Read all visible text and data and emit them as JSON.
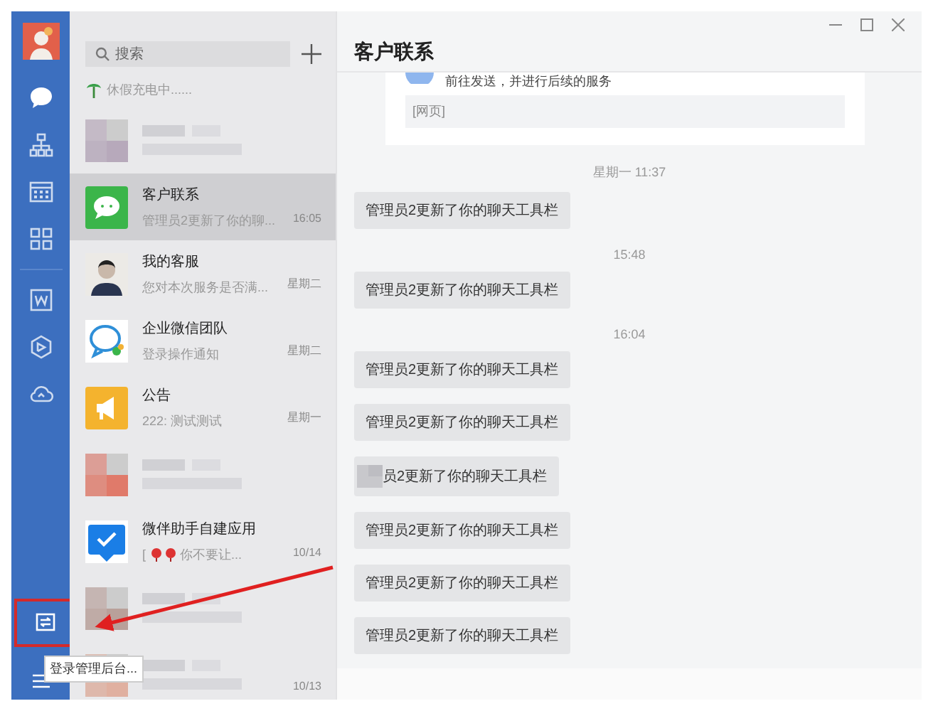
{
  "sidebar": {
    "nav": [
      {
        "kind": "chat",
        "selected": true
      },
      {
        "kind": "org",
        "selected": false
      },
      {
        "kind": "calendar",
        "selected": false
      },
      {
        "kind": "apps",
        "selected": false
      },
      {
        "kind": "doc",
        "selected": false
      },
      {
        "kind": "hex",
        "selected": false
      },
      {
        "kind": "cloud",
        "selected": false
      }
    ],
    "bottom": [
      {
        "kind": "admin",
        "highlighted": true
      },
      {
        "kind": "menu",
        "highlighted": false
      }
    ],
    "tooltip": "登录管理后台..."
  },
  "search": {
    "placeholder": "搜索"
  },
  "status": "休假充电中......",
  "conversations": [
    {
      "kind": "blurred",
      "color": "#b7a9bb",
      "selected": false
    },
    {
      "kind": "bubble",
      "name": "客户联系",
      "preview": "管理员2更新了你的聊...",
      "time": "16:05",
      "selected": true
    },
    {
      "kind": "person",
      "name": "我的客服",
      "preview": "您对本次服务是否满...",
      "time": "星期二",
      "selected": false
    },
    {
      "kind": "team",
      "name": "企业微信团队",
      "preview": "登录操作通知",
      "time": "星期二",
      "selected": false
    },
    {
      "kind": "megaphone",
      "name": "公告",
      "preview": "222: 测试测试",
      "time": "星期一",
      "selected": false
    },
    {
      "kind": "blurred",
      "color": "#e07a6a",
      "selected": false
    },
    {
      "kind": "check",
      "name": "微伴助手自建应用",
      "prefix": "[",
      "preview": "你不要让...",
      "time": "10/14",
      "selected": false
    },
    {
      "kind": "blurred",
      "color": "#b9a09a",
      "selected": false
    },
    {
      "kind": "blurred",
      "color": "#e0b0a0",
      "time": "10/13",
      "selected": false
    }
  ],
  "chat": {
    "title": "客户联系",
    "card": {
      "text": "前往发送，并进行后续的服务",
      "link": "[网页]"
    },
    "messages": [
      {
        "kind": "time",
        "text": "星期一 11:37"
      },
      {
        "kind": "message",
        "text": "管理员2更新了你的聊天工具栏"
      },
      {
        "kind": "time",
        "text": "15:48"
      },
      {
        "kind": "message",
        "text": "管理员2更新了你的聊天工具栏"
      },
      {
        "kind": "time",
        "text": "16:04"
      },
      {
        "kind": "message",
        "text": "管理员2更新了你的聊天工具栏"
      },
      {
        "kind": "message",
        "text": "管理员2更新了你的聊天工具栏"
      },
      {
        "kind": "message",
        "text": "员2更新了你的聊天工具栏",
        "obscured": true
      },
      {
        "kind": "message",
        "text": "管理员2更新了你的聊天工具栏"
      },
      {
        "kind": "message",
        "text": "管理员2更新了你的聊天工具栏"
      },
      {
        "kind": "message",
        "text": "管理员2更新了你的聊天工具栏"
      }
    ]
  }
}
